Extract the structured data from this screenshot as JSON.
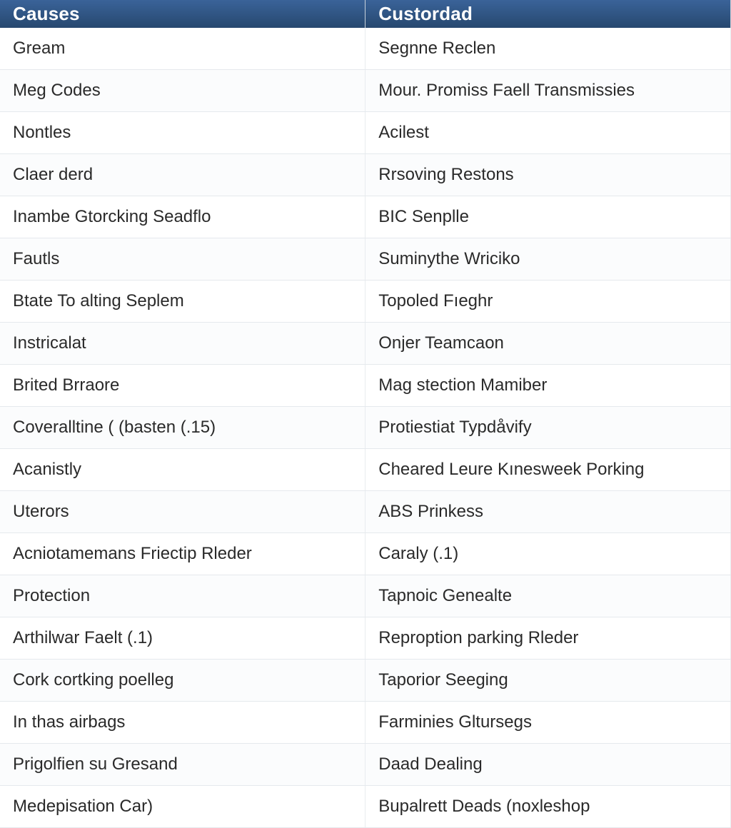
{
  "table": {
    "headers": {
      "left": "Causes",
      "right": "Custordad"
    },
    "rows": [
      {
        "left": "Gream",
        "right": "Segnne Reclen"
      },
      {
        "left": "Meg Codes",
        "right": "Mour. Promiss Faell Transmissies"
      },
      {
        "left": "Nontles",
        "right": "Acilest"
      },
      {
        "left": "Claer derd",
        "right": "Rrsoving Restons"
      },
      {
        "left": "Inambe Gtorcking Seadflo",
        "right": "BIC Senplle"
      },
      {
        "left": "Fautls",
        "right": "Suminythe Wriciko"
      },
      {
        "left": "Btate To alting Seplem",
        "right": "Topoled Fıeghr"
      },
      {
        "left": "Instricalat",
        "right": "Onjer Teamcaon"
      },
      {
        "left": "Brited Brraore",
        "right": "Mag stection Mamiber"
      },
      {
        "left": "Coveralltine ( (basten (.15)",
        "right": "Protiestiat Typdåvify"
      },
      {
        "left": "Acanistly",
        "right": "Cheared Leure Kınesweek Porking"
      },
      {
        "left": "Uterors",
        "right": "ABS Prinkess"
      },
      {
        "left": "Acniotamemans Friectip Rleder",
        "right": "Caraly (.1)"
      },
      {
        "left": "Protection",
        "right": "Tapnoic Genealte"
      },
      {
        "left": "Arthilwar Faelt (.1)",
        "right": "Reproption parking Rleder"
      },
      {
        "left": "Cork cortking poelleg",
        "right": "Taporior Seeging"
      },
      {
        "left": "In thas airbags",
        "right": "Farminies Gltursegs"
      },
      {
        "left": "Prigolfien su Gresand",
        "right": "Daad Dealing"
      },
      {
        "left": "Medepisation Car)",
        "right": "Bupalrett Deads (noxleshop"
      }
    ]
  }
}
